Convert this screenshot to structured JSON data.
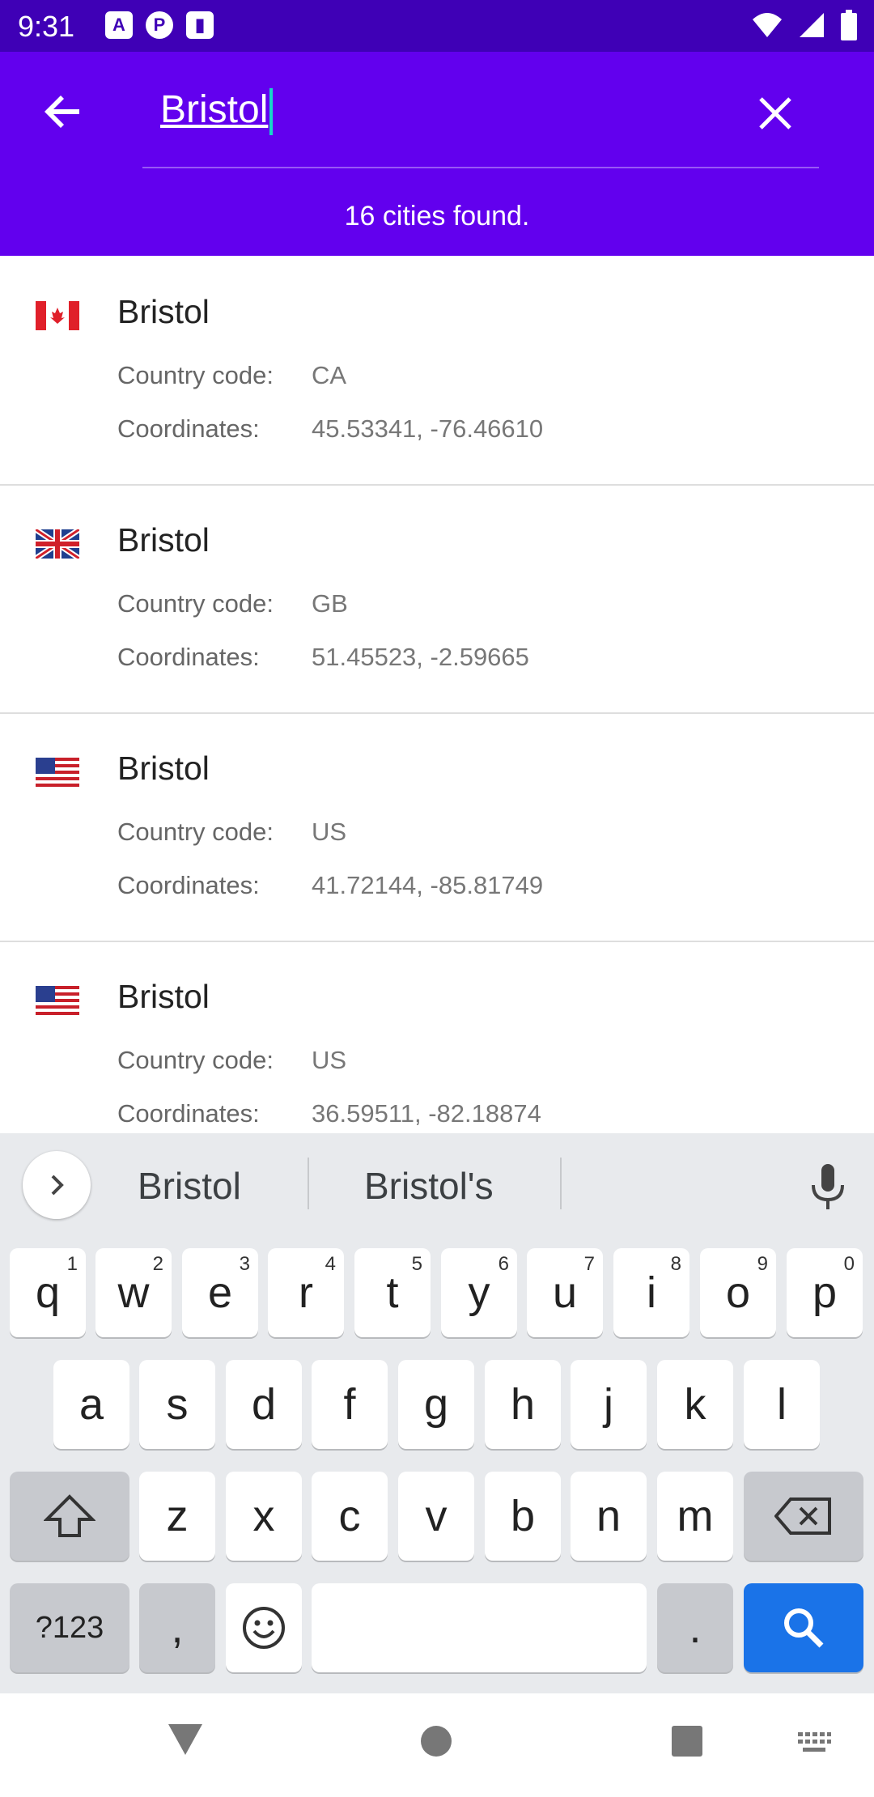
{
  "status": {
    "time": "9:31",
    "icons": [
      "a-icon",
      "pocket-icon",
      "sd-card-icon",
      "wifi-icon",
      "signal-icon",
      "battery-icon"
    ]
  },
  "search": {
    "query": "Bristol",
    "result_count": "16 cities found."
  },
  "labels": {
    "country_code": "Country code:",
    "coordinates": "Coordinates:"
  },
  "results": [
    {
      "name": "Bristol",
      "country": "CA",
      "coords": "45.53341, -76.46610",
      "flag": "canada-flag"
    },
    {
      "name": "Bristol",
      "country": "GB",
      "coords": "51.45523, -2.59665",
      "flag": "uk-flag"
    },
    {
      "name": "Bristol",
      "country": "US",
      "coords": "41.72144, -85.81749",
      "flag": "us-flag"
    },
    {
      "name": "Bristol",
      "country": "US",
      "coords": "36.59511, -82.18874",
      "flag": "us-flag"
    }
  ],
  "keyboard": {
    "suggestions": [
      "Bristol",
      "Bristol's"
    ],
    "row1": [
      "q",
      "w",
      "e",
      "r",
      "t",
      "y",
      "u",
      "i",
      "o",
      "p"
    ],
    "row1_nums": [
      "1",
      "2",
      "3",
      "4",
      "5",
      "6",
      "7",
      "8",
      "9",
      "0"
    ],
    "row2": [
      "a",
      "s",
      "d",
      "f",
      "g",
      "h",
      "j",
      "k",
      "l"
    ],
    "row3": [
      "z",
      "x",
      "c",
      "v",
      "b",
      "n",
      "m"
    ],
    "symbols_key": "?123",
    "comma_key": ",",
    "period_key": "."
  },
  "colors": {
    "statusbar": "#3f00b6",
    "appbar": "#6200ee",
    "accent_caret": "#18d6c8",
    "search_key": "#1a73e8"
  }
}
